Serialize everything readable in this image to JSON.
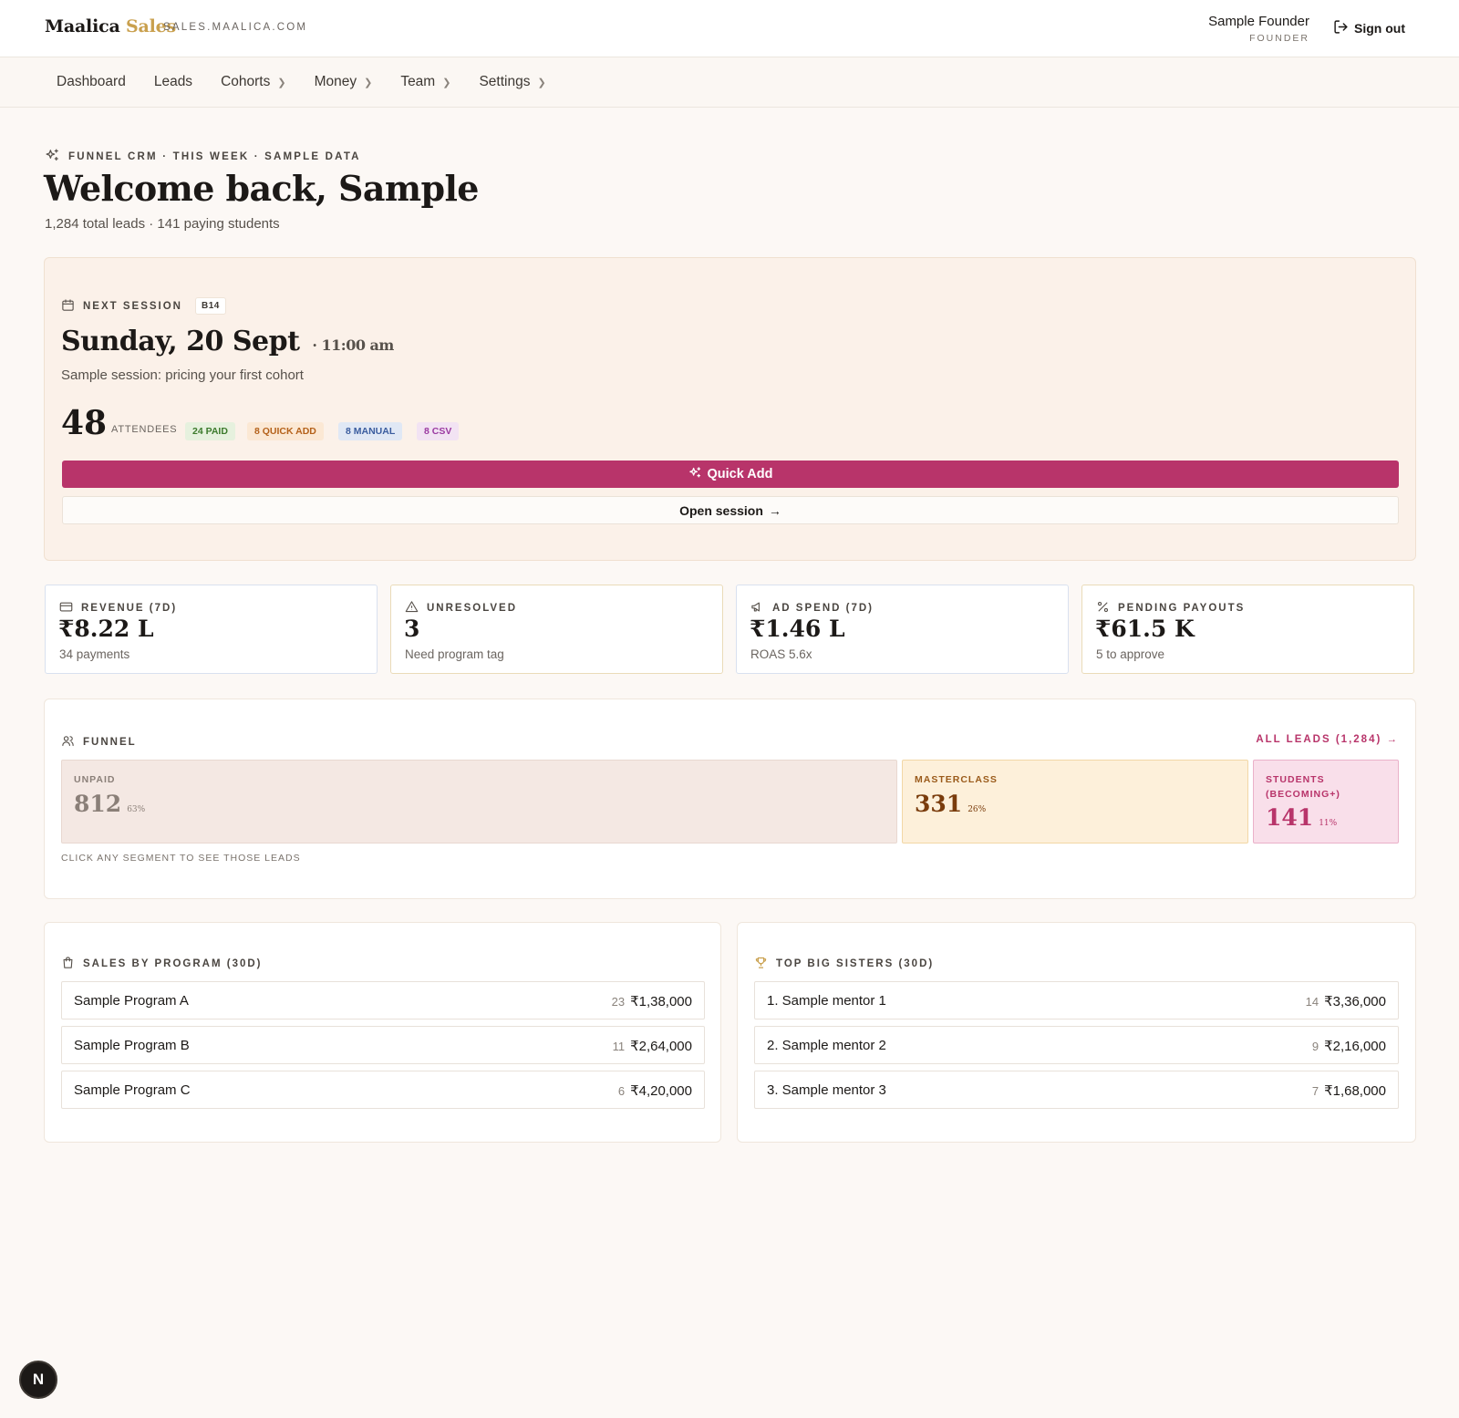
{
  "header": {
    "brand_main": "Maalica",
    "brand_accent": "Sales",
    "domain": "SALES.MAALICA.COM",
    "user_name": "Sample Founder",
    "user_role": "FOUNDER",
    "signout_label": "Sign out"
  },
  "nav": {
    "items": [
      {
        "label": "Dashboard",
        "has_chevron": false
      },
      {
        "label": "Leads",
        "has_chevron": false
      },
      {
        "label": "Cohorts",
        "has_chevron": true
      },
      {
        "label": "Money",
        "has_chevron": true
      },
      {
        "label": "Team",
        "has_chevron": true
      },
      {
        "label": "Settings",
        "has_chevron": true
      }
    ]
  },
  "hero": {
    "eyebrow": "FUNNEL CRM · THIS WEEK · SAMPLE DATA",
    "title": "Welcome back, Sample",
    "subtitle": "1,284 total leads · 141 paying students"
  },
  "session": {
    "label": "NEXT SESSION",
    "badge": "B14",
    "date": "Sunday, 20 Sept",
    "time": "· 11:00 am",
    "description": "Sample session: pricing your first cohort",
    "attendees_count": "48",
    "attendees_label": "ATTENDEES",
    "tags": {
      "paid": "24 PAID",
      "quick_add": "8 QUICK ADD",
      "manual": "8 MANUAL",
      "csv": "8 CSV"
    },
    "quick_add_label": "Quick Add",
    "open_session_label": "Open session"
  },
  "stats": [
    {
      "label": "REVENUE (7D)",
      "value": "₹8.22 L",
      "sub": "34 payments",
      "icon": "credit-card-icon"
    },
    {
      "label": "UNRESOLVED",
      "value": "3",
      "sub": "Need program tag",
      "icon": "alert-triangle-icon"
    },
    {
      "label": "AD SPEND (7D)",
      "value": "₹1.46 L",
      "sub": "ROAS 5.6x",
      "icon": "megaphone-icon"
    },
    {
      "label": "PENDING PAYOUTS",
      "value": "₹61.5 K",
      "sub": "5 to approve",
      "icon": "percent-icon"
    }
  ],
  "funnel": {
    "label": "FUNNEL",
    "all_leads_label": "ALL LEADS (1,284) →",
    "segments": [
      {
        "label": "UNPAID",
        "value": "812",
        "percent": "63%"
      },
      {
        "label": "MASTERCLASS",
        "value": "331",
        "percent": "26%"
      },
      {
        "label": "STUDENTS (BECOMING+)",
        "value": "141",
        "percent": "11%"
      }
    ],
    "hint": "CLICK ANY SEGMENT TO SEE THOSE LEADS"
  },
  "sales_by_program": {
    "label": "SALES BY PROGRAM (30D)",
    "rows": [
      {
        "name": "Sample Program A",
        "count": "23",
        "amount": "₹1,38,000"
      },
      {
        "name": "Sample Program B",
        "count": "11",
        "amount": "₹2,64,000"
      },
      {
        "name": "Sample Program C",
        "count": "6",
        "amount": "₹4,20,000"
      }
    ]
  },
  "top_big_sisters": {
    "label": "TOP BIG SISTERS (30D)",
    "rows": [
      {
        "name": "1. Sample mentor 1",
        "count": "14",
        "amount": "₹3,36,000"
      },
      {
        "name": "2. Sample mentor 2",
        "count": "9",
        "amount": "₹2,16,000"
      },
      {
        "name": "3. Sample mentor 3",
        "count": "7",
        "amount": "₹1,68,000"
      }
    ]
  },
  "floating_badge": "N",
  "colors": {
    "accent": "#b8346a",
    "brand_gold": "#c9a04e",
    "background": "#fcf8f5"
  }
}
